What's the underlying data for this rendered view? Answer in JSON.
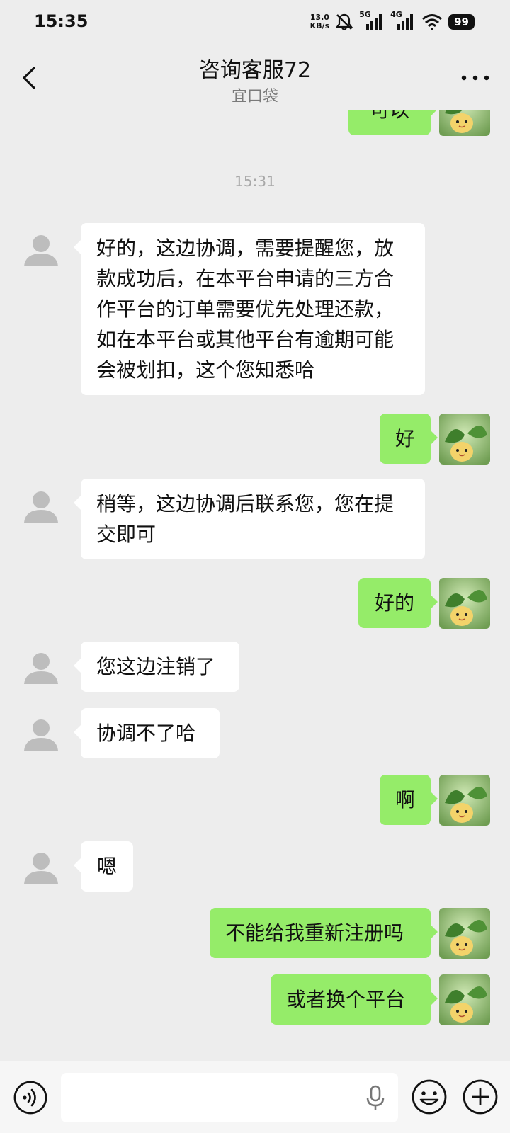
{
  "status_bar": {
    "time": "15:35",
    "net_speed_value": "13.0",
    "net_speed_unit": "KB/s",
    "signal_5g": "5G",
    "signal_4g": "4G",
    "battery": "99"
  },
  "header": {
    "title": "咨询客服72",
    "subtitle": "宜口袋"
  },
  "chat": {
    "partial_top_text": "可以",
    "timestamp": "15:31",
    "messages": [
      {
        "side": "left",
        "text": "好的，这边协调，需要提醒您，放款成功后，在本平台申请的三方合作平台的订单需要优先处理还款，如在本平台或其他平台有逾期可能会被划扣，这个您知悉哈"
      },
      {
        "side": "right",
        "text": "好"
      },
      {
        "side": "left",
        "text": "稍等，这边协调后联系您，您在提交即可"
      },
      {
        "side": "right",
        "text": "好的"
      },
      {
        "side": "left",
        "text": "您这边注销了"
      },
      {
        "side": "left",
        "text": "协调不了哈"
      },
      {
        "side": "right",
        "text": "啊"
      },
      {
        "side": "left",
        "text": "嗯"
      },
      {
        "side": "right",
        "text": "不能给我重新注册吗"
      },
      {
        "side": "right",
        "text": "或者换个平台"
      }
    ]
  },
  "input_bar": {
    "value": "",
    "placeholder": ""
  },
  "colors": {
    "background": "#ededed",
    "bubble_self": "#95ec69",
    "bubble_other": "#ffffff",
    "timestamp": "#a8a8a8"
  },
  "icons": {
    "back": "chevron-left-icon",
    "more": "more-dots-icon",
    "voice": "voice-icon",
    "mic": "microphone-icon",
    "emoji": "emoji-icon",
    "plus": "plus-icon"
  }
}
